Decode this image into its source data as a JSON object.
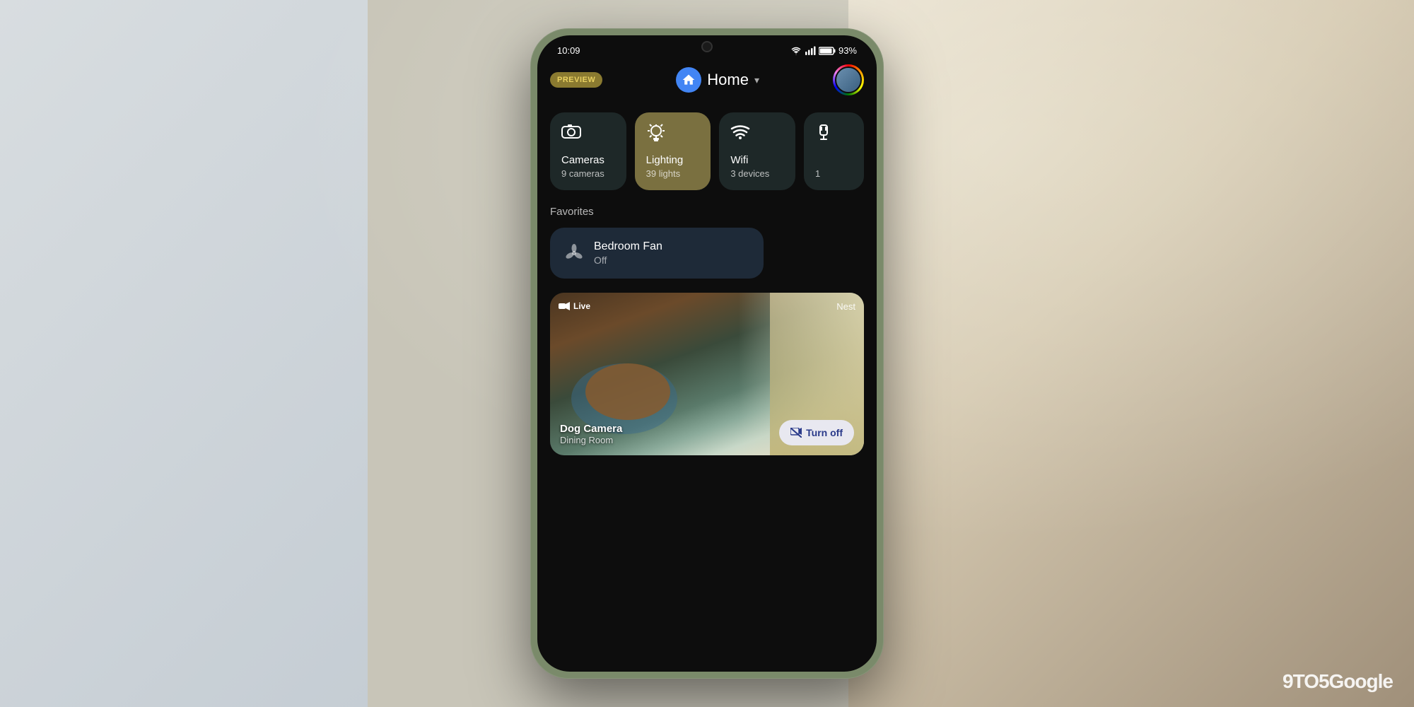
{
  "background": {
    "left_color": "#d0d5d8",
    "right_color": "#c8b898"
  },
  "watermark": "9TO5Google",
  "phone": {
    "shell_color": "#7a8a6a"
  },
  "status_bar": {
    "time": "10:09",
    "icons": [
      "notification",
      "twitter",
      "mail"
    ],
    "battery": "93%",
    "signal": "full"
  },
  "header": {
    "preview_label": "PREVIEW",
    "title": "Home",
    "chevron": "▾",
    "home_icon": "🏠"
  },
  "devices": [
    {
      "id": "cameras",
      "name": "Cameras",
      "count": "9 cameras",
      "active": false,
      "icon": "camera"
    },
    {
      "id": "lighting",
      "name": "Lighting",
      "count": "39 lights",
      "active": true,
      "icon": "light"
    },
    {
      "id": "wifi",
      "name": "Wifi",
      "count": "3 devices",
      "active": false,
      "icon": "wifi"
    },
    {
      "id": "other",
      "name": "",
      "count": "1",
      "active": false,
      "icon": "more",
      "partial": true
    }
  ],
  "favorites": {
    "label": "Favorites",
    "items": [
      {
        "id": "bedroom-fan",
        "name": "Bedroom Fan",
        "status": "Off",
        "icon": "fan"
      }
    ]
  },
  "camera_feed": {
    "live_label": "Live",
    "brand": "Nest",
    "camera_name": "Dog Camera",
    "camera_room": "Dining Room",
    "turn_off_label": "Turn off"
  }
}
